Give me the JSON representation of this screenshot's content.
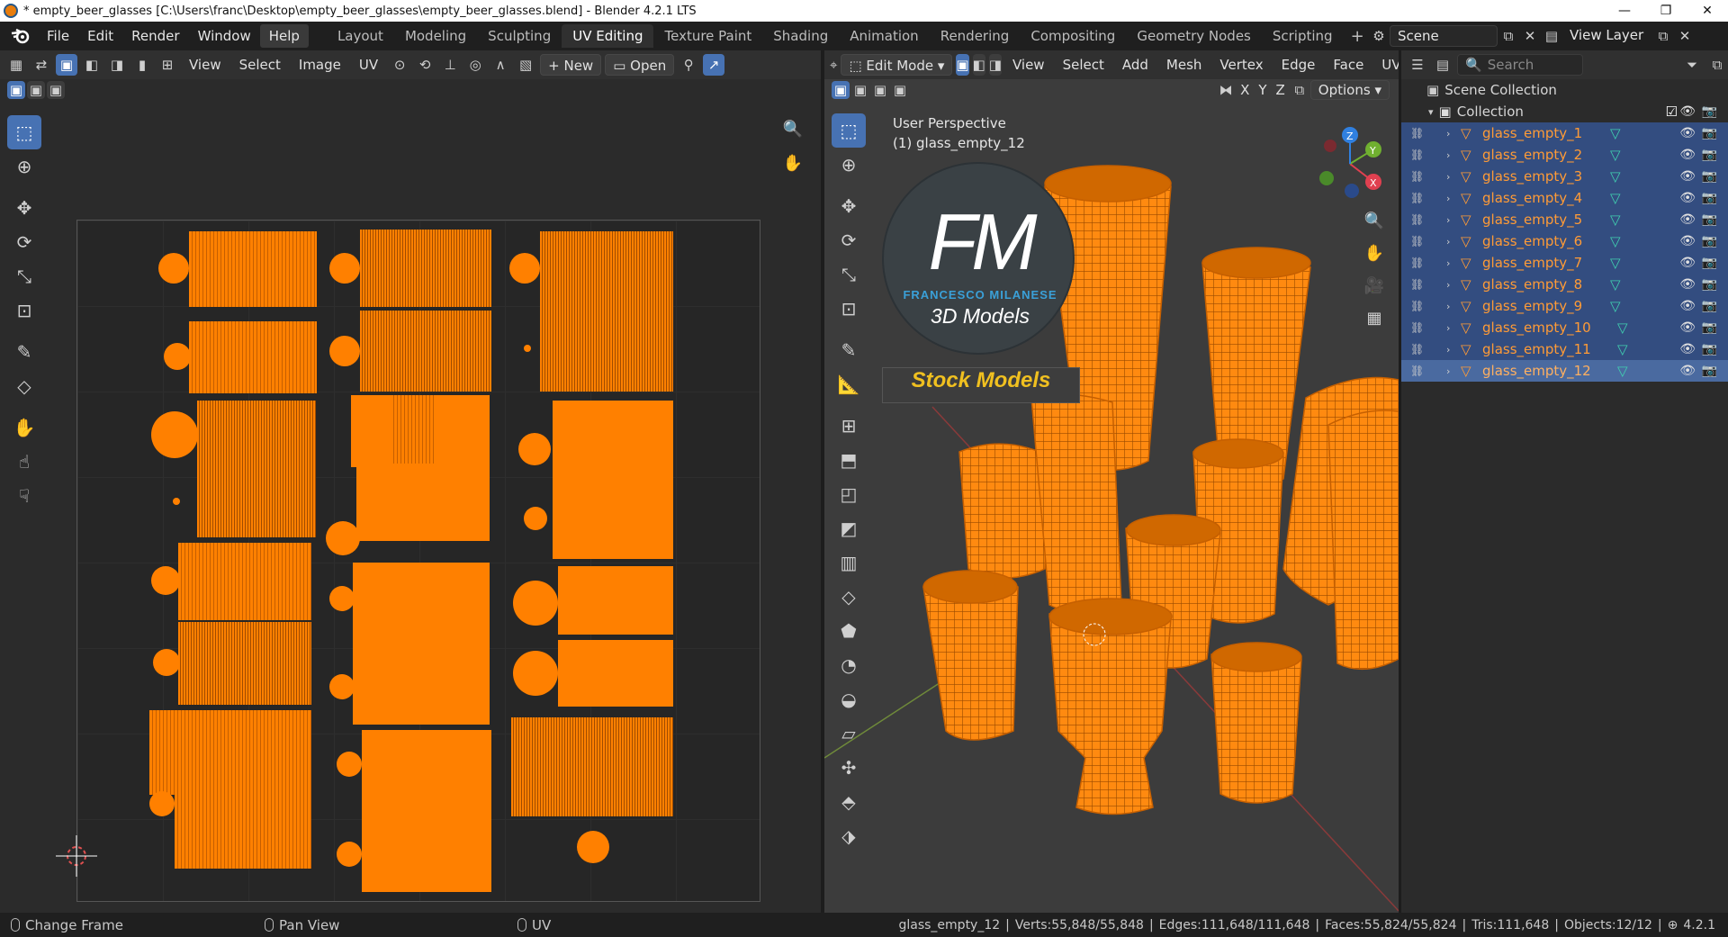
{
  "window": {
    "title": "* empty_beer_glasses [C:\\Users\\franc\\Desktop\\empty_beer_glasses\\empty_beer_glasses.blend] - Blender 4.2.1 LTS"
  },
  "menus": [
    "File",
    "Edit",
    "Render",
    "Window",
    "Help"
  ],
  "workspaces": [
    "Layout",
    "Modeling",
    "Sculpting",
    "UV Editing",
    "Texture Paint",
    "Shading",
    "Animation",
    "Rendering",
    "Compositing",
    "Geometry Nodes",
    "Scripting"
  ],
  "active_workspace": "UV Editing",
  "scene": {
    "label": "Scene",
    "view_layer": "View Layer"
  },
  "uv_editor": {
    "menus": [
      "View",
      "Select",
      "Image",
      "UV"
    ],
    "new_label": "New",
    "open_label": "Open"
  },
  "viewport": {
    "mode": "Edit Mode",
    "menus": [
      "View",
      "Select",
      "Add",
      "Mesh",
      "Vertex",
      "Edge",
      "Face",
      "UV"
    ],
    "axes": [
      "X",
      "Y",
      "Z"
    ],
    "options_label": "Options",
    "overlay_line1": "User Perspective",
    "overlay_line2": "(1) glass_empty_12"
  },
  "watermark": {
    "letters": "FM",
    "brand": "FRANCESCO MILANESE",
    "sub": "3D Models",
    "badge": "Stock Models"
  },
  "gizmo": {
    "x": "X",
    "y": "Y",
    "z": "Z"
  },
  "outliner": {
    "search_placeholder": "Search",
    "scene_collection": "Scene Collection",
    "collection": "Collection",
    "items": [
      "glass_empty_1",
      "glass_empty_2",
      "glass_empty_3",
      "glass_empty_4",
      "glass_empty_5",
      "glass_empty_6",
      "glass_empty_7",
      "glass_empty_8",
      "glass_empty_9",
      "glass_empty_10",
      "glass_empty_11",
      "glass_empty_12"
    ],
    "active_item": "glass_empty_12"
  },
  "status": {
    "hint1": "Change Frame",
    "hint2": "Pan View",
    "hint3": "UV",
    "object": "glass_empty_12",
    "verts": "Verts:55,848/55,848",
    "edges": "Edges:111,648/111,648",
    "faces": "Faces:55,824/55,824",
    "tris": "Tris:111,648",
    "objects": "Objects:12/12",
    "version": "4.2.1"
  },
  "colors": {
    "accent": "#4772b3",
    "selection": "#ff8000",
    "outliner_selected": "#334d80"
  }
}
